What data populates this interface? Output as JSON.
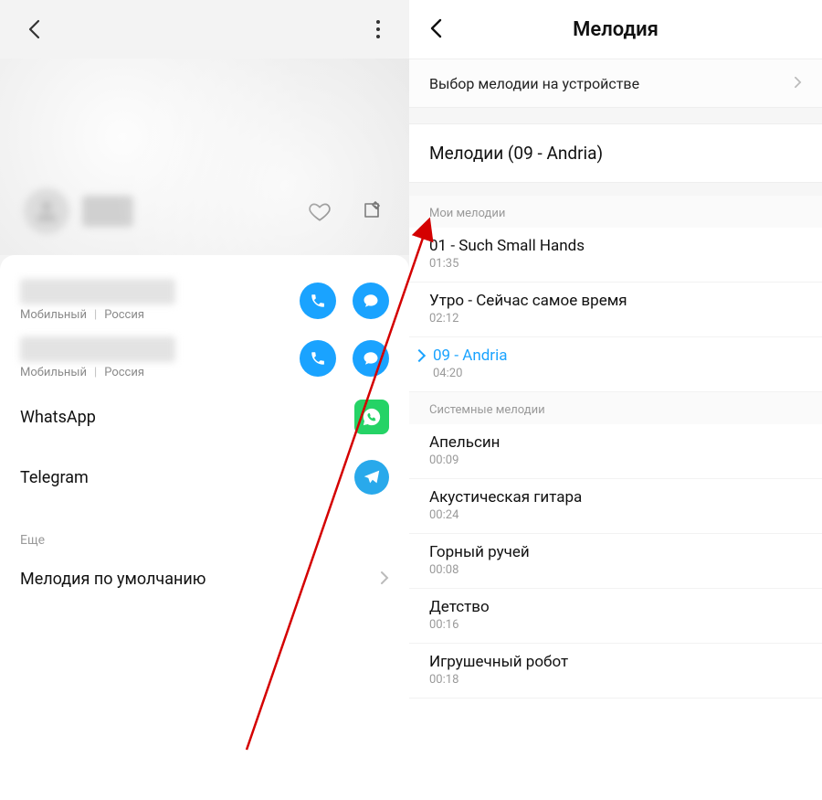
{
  "left": {
    "phone1_type": "Мобильный",
    "phone1_region": "Россия",
    "phone2_type": "Мобильный",
    "phone2_region": "Россия",
    "app_whatsapp": "WhatsApp",
    "app_telegram": "Telegram",
    "more_section": "Еще",
    "default_ringtone": "Мелодия по умолчанию"
  },
  "right": {
    "title": "Мелодия",
    "picker": "Выбор мелодии на устройстве",
    "current": "Мелодии (09 - Andria)",
    "my_section": "Мои мелодии",
    "my_items": [
      {
        "title": "01 - Such Small Hands",
        "dur": "01:35",
        "selected": false
      },
      {
        "title": "Утро - Сейчас самое время",
        "dur": "02:12",
        "selected": false
      },
      {
        "title": "09 - Andria",
        "dur": "04:20",
        "selected": true
      }
    ],
    "sys_section": "Системные мелодии",
    "sys_items": [
      {
        "title": "Апельсин",
        "dur": "00:09"
      },
      {
        "title": "Акустическая гитара",
        "dur": "00:24"
      },
      {
        "title": "Горный ручей",
        "dur": "00:08"
      },
      {
        "title": "Детство",
        "dur": "00:16"
      },
      {
        "title": "Игрушечный робот",
        "dur": "00:18"
      }
    ]
  }
}
